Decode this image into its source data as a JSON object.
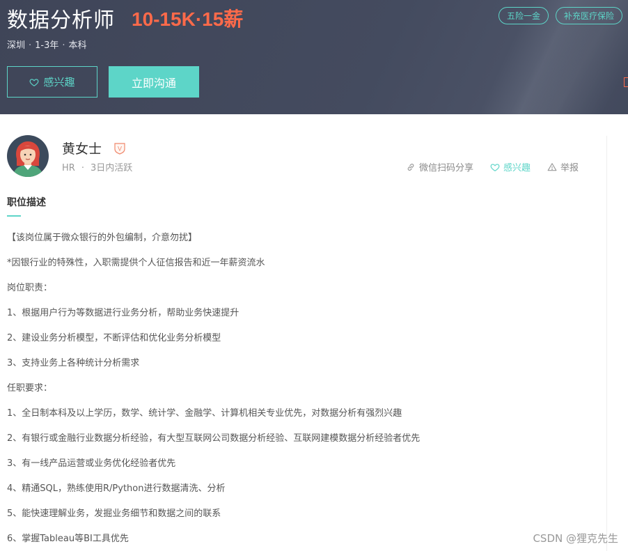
{
  "job": {
    "title": "数据分析师",
    "salary": "10-15K·15薪",
    "city": "深圳",
    "experience": "1-3年",
    "education": "本科",
    "meta_separator": "·",
    "tags": [
      "五险一金",
      "补充医疗保险"
    ],
    "interest_button": "感兴趣",
    "chat_button": "立即沟通"
  },
  "recruiter": {
    "name": "黄女士",
    "role": "HR",
    "separator": "·",
    "activity": "3日内活跃",
    "verify_badge": "V"
  },
  "actions": {
    "share": "微信扫码分享",
    "favorite": "感兴趣",
    "report": "举报"
  },
  "description": {
    "title": "职位描述",
    "lines": [
      "【该岗位属于微众银行的外包编制，介意勿扰】",
      "*因银行业的特殊性，入职需提供个人征信报告和近一年薪资流水",
      "岗位职责：",
      "1、根据用户行为等数据进行业务分析，帮助业务快速提升",
      "2、建设业务分析模型，不断评估和优化业务分析模型",
      "3、支持业务上各种统计分析需求",
      "任职要求：",
      "1、全日制本科及以上学历，数学、统计学、金融学、计算机相关专业优先，对数据分析有强烈兴趣",
      "2、有银行或金融行业数据分析经验，有大型互联网公司数据分析经验、互联网建模数据分析经验者优先",
      "3、有一线产品运营或业务优化经验者优先",
      "4、精通SQL，熟练使用R/Python进行数据清洗、分析",
      "5、能快速理解业务，发掘业务细节和数据之间的联系",
      "6、掌握Tableau等BI工具优先"
    ]
  },
  "watermark": "CSDN @狸克先生",
  "colors": {
    "accent": "#5dd5c8",
    "salary": "#fd6a4a",
    "banner": "#444b5f"
  },
  "icons": {
    "interest": "heart-outline-icon",
    "share": "link-icon",
    "favorite": "heart-outline-icon",
    "report": "warning-triangle-icon",
    "verify": "verified-shield-icon"
  }
}
